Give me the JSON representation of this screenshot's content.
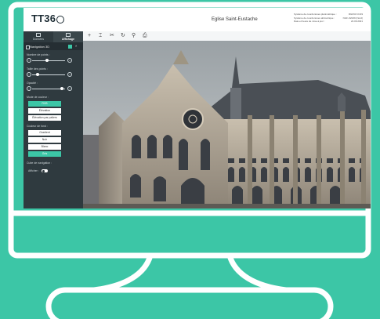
{
  "header": {
    "logo_text": "TT36",
    "title": "Eglise Saint-Eustache",
    "meta": [
      {
        "label": "Système de coordonnées planimétrique :",
        "value": "RGF93 CC49"
      },
      {
        "label": "Système de coordonnées altimétrique :",
        "value": "NGF-IGN69 (Nord)"
      },
      {
        "label": "Date et heure de mise à jour :",
        "value": "24.09.2021"
      }
    ]
  },
  "sidebar": {
    "tabs": [
      {
        "label": "Données",
        "icon": "layers-icon",
        "active": false
      },
      {
        "label": "Affichage",
        "icon": "display-icon",
        "active": true
      }
    ],
    "navigation": {
      "label": "Navigation 3D",
      "checked": true
    },
    "sliders": [
      {
        "label": "Nombre de points :",
        "value": 0.45
      },
      {
        "label": "Taille des points :",
        "value": 0.12
      },
      {
        "label": "Opacité :",
        "value": 0.95
      }
    ],
    "color_mode": {
      "label": "Mode de couleur :",
      "options": [
        "RVB",
        "Élévation",
        "Élévation par paliers"
      ],
      "selected": 0
    },
    "background": {
      "label": "Couleur de fond :",
      "options": [
        "Gradient",
        "Noir",
        "Blanc",
        "Gris"
      ],
      "selected": 3
    },
    "navigation_cube": {
      "label": "Cube de navigation :",
      "toggle_label": "Afficher :",
      "on": false
    }
  },
  "toolbar": {
    "tools": [
      {
        "name": "move-tool",
        "glyph": "+"
      },
      {
        "name": "measure-tool",
        "glyph": "⌶"
      },
      {
        "name": "cut-tool",
        "glyph": "✂"
      },
      {
        "name": "reset-view-tool",
        "glyph": "↻"
      },
      {
        "name": "location-tool",
        "glyph": "⚲"
      },
      {
        "name": "print-tool",
        "glyph": "⎙"
      }
    ]
  },
  "colors": {
    "accent": "#3cc6a6",
    "sidebar": "#2f3a3f",
    "background": "#3cc6a6"
  }
}
